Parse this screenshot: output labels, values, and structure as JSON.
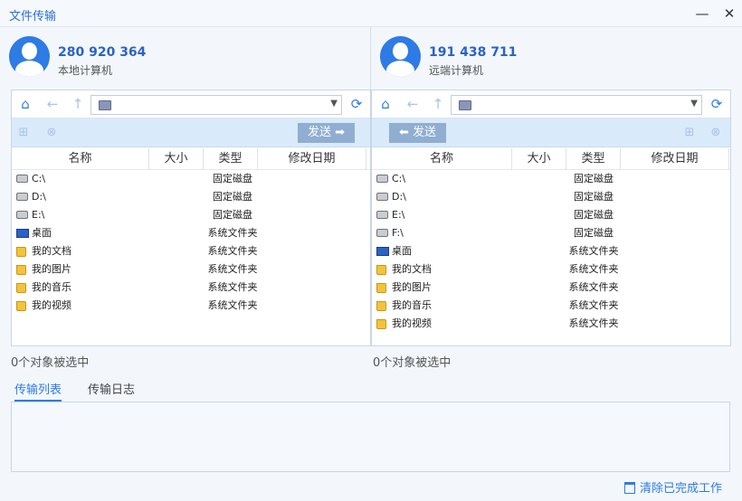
{
  "window": {
    "title": "文件传输",
    "min_icon": "minimize-icon",
    "close_icon": "close-icon"
  },
  "local": {
    "id": "280 920 364",
    "label": "本地计算机"
  },
  "remote": {
    "id": "191 438 711",
    "label": "远端计算机"
  },
  "send": {
    "right_label": "发送",
    "left_label": "发送"
  },
  "columns": {
    "name": "名称",
    "size": "大小",
    "type": "类型",
    "date": "修改日期"
  },
  "local_files": [
    {
      "icon": "drive",
      "name": "C:\\",
      "type": "固定磁盘"
    },
    {
      "icon": "drive",
      "name": "D:\\",
      "type": "固定磁盘"
    },
    {
      "icon": "drive",
      "name": "E:\\",
      "type": "固定磁盘"
    },
    {
      "icon": "desktop",
      "name": "桌面",
      "type": "系统文件夹"
    },
    {
      "icon": "folder",
      "name": "我的文档",
      "type": "系统文件夹"
    },
    {
      "icon": "folder",
      "name": "我的图片",
      "type": "系统文件夹"
    },
    {
      "icon": "folder",
      "name": "我的音乐",
      "type": "系统文件夹"
    },
    {
      "icon": "folder",
      "name": "我的视频",
      "type": "系统文件夹"
    }
  ],
  "remote_files": [
    {
      "icon": "drive",
      "name": "C:\\",
      "type": "固定磁盘"
    },
    {
      "icon": "drive",
      "name": "D:\\",
      "type": "固定磁盘"
    },
    {
      "icon": "drive",
      "name": "E:\\",
      "type": "固定磁盘"
    },
    {
      "icon": "drive",
      "name": "F:\\",
      "type": "固定磁盘"
    },
    {
      "icon": "desktop",
      "name": "桌面",
      "type": "系统文件夹"
    },
    {
      "icon": "folder",
      "name": "我的文档",
      "type": "系统文件夹"
    },
    {
      "icon": "folder",
      "name": "我的图片",
      "type": "系统文件夹"
    },
    {
      "icon": "folder",
      "name": "我的音乐",
      "type": "系统文件夹"
    },
    {
      "icon": "folder",
      "name": "我的视频",
      "type": "系统文件夹"
    }
  ],
  "status": {
    "local": "0个对象被选中",
    "remote": "0个对象被选中"
  },
  "tabs": {
    "transfer_list": "传输列表",
    "transfer_log": "传输日志"
  },
  "clear_label": "清除已完成工作",
  "colors": {
    "accent": "#2d7be5",
    "send_button": "#8faed1",
    "action_bar": "#d9eafb"
  }
}
